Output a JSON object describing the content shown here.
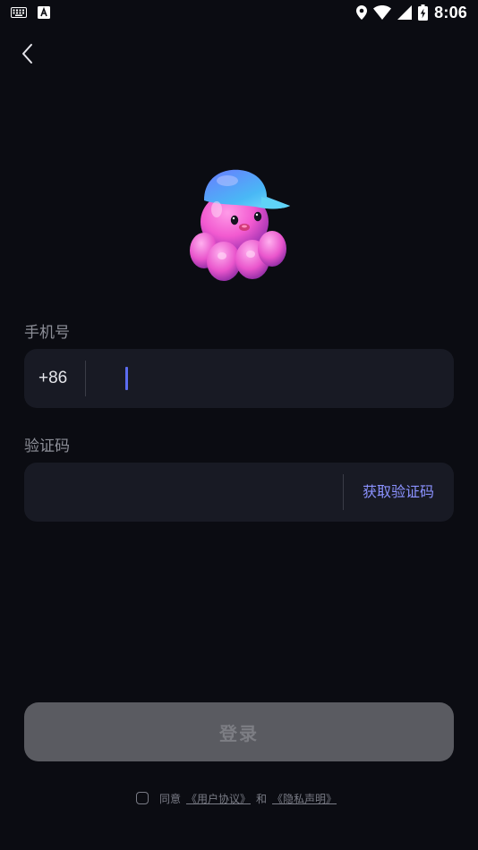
{
  "status_bar": {
    "time": "8:06",
    "left_icons": [
      "keyboard-icon",
      "font-a-icon"
    ],
    "right_icons": [
      "location-icon",
      "wifi-icon",
      "signal-icon",
      "battery-charging-icon"
    ]
  },
  "nav": {
    "back_icon": "chevron-left-icon"
  },
  "mascot": {
    "description_icon": "octopus-mascot-icon"
  },
  "phone": {
    "label": "手机号",
    "country_code": "+86",
    "value": "",
    "placeholder": ""
  },
  "code": {
    "label": "验证码",
    "value": "",
    "placeholder": "",
    "get_code_label": "获取验证码"
  },
  "login": {
    "label": "登录"
  },
  "agreement": {
    "agree_text": "同意",
    "user_agreement": "《用户协议》",
    "and_text": "和",
    "privacy_statement": "《隐私声明》",
    "checked": false
  },
  "colors": {
    "background": "#0b0c12",
    "field_bg": "#181a24",
    "accent": "#8b92ff",
    "caret": "#5b6cf0",
    "login_bg": "#5a5b61"
  }
}
